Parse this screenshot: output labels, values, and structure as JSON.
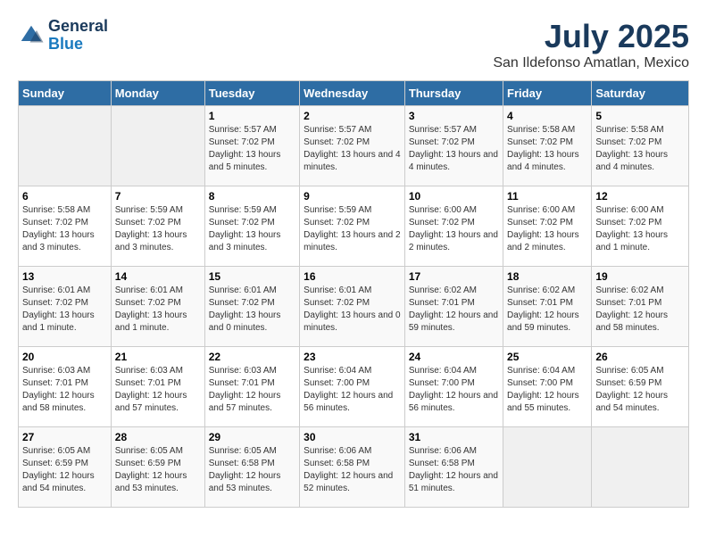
{
  "logo": {
    "line1": "General",
    "line2": "Blue"
  },
  "title": "July 2025",
  "subtitle": "San Ildefonso Amatlan, Mexico",
  "weekdays": [
    "Sunday",
    "Monday",
    "Tuesday",
    "Wednesday",
    "Thursday",
    "Friday",
    "Saturday"
  ],
  "weeks": [
    [
      {
        "day": "",
        "info": ""
      },
      {
        "day": "",
        "info": ""
      },
      {
        "day": "1",
        "info": "Sunrise: 5:57 AM\nSunset: 7:02 PM\nDaylight: 13 hours and 5 minutes."
      },
      {
        "day": "2",
        "info": "Sunrise: 5:57 AM\nSunset: 7:02 PM\nDaylight: 13 hours and 4 minutes."
      },
      {
        "day": "3",
        "info": "Sunrise: 5:57 AM\nSunset: 7:02 PM\nDaylight: 13 hours and 4 minutes."
      },
      {
        "day": "4",
        "info": "Sunrise: 5:58 AM\nSunset: 7:02 PM\nDaylight: 13 hours and 4 minutes."
      },
      {
        "day": "5",
        "info": "Sunrise: 5:58 AM\nSunset: 7:02 PM\nDaylight: 13 hours and 4 minutes."
      }
    ],
    [
      {
        "day": "6",
        "info": "Sunrise: 5:58 AM\nSunset: 7:02 PM\nDaylight: 13 hours and 3 minutes."
      },
      {
        "day": "7",
        "info": "Sunrise: 5:59 AM\nSunset: 7:02 PM\nDaylight: 13 hours and 3 minutes."
      },
      {
        "day": "8",
        "info": "Sunrise: 5:59 AM\nSunset: 7:02 PM\nDaylight: 13 hours and 3 minutes."
      },
      {
        "day": "9",
        "info": "Sunrise: 5:59 AM\nSunset: 7:02 PM\nDaylight: 13 hours and 2 minutes."
      },
      {
        "day": "10",
        "info": "Sunrise: 6:00 AM\nSunset: 7:02 PM\nDaylight: 13 hours and 2 minutes."
      },
      {
        "day": "11",
        "info": "Sunrise: 6:00 AM\nSunset: 7:02 PM\nDaylight: 13 hours and 2 minutes."
      },
      {
        "day": "12",
        "info": "Sunrise: 6:00 AM\nSunset: 7:02 PM\nDaylight: 13 hours and 1 minute."
      }
    ],
    [
      {
        "day": "13",
        "info": "Sunrise: 6:01 AM\nSunset: 7:02 PM\nDaylight: 13 hours and 1 minute."
      },
      {
        "day": "14",
        "info": "Sunrise: 6:01 AM\nSunset: 7:02 PM\nDaylight: 13 hours and 1 minute."
      },
      {
        "day": "15",
        "info": "Sunrise: 6:01 AM\nSunset: 7:02 PM\nDaylight: 13 hours and 0 minutes."
      },
      {
        "day": "16",
        "info": "Sunrise: 6:01 AM\nSunset: 7:02 PM\nDaylight: 13 hours and 0 minutes."
      },
      {
        "day": "17",
        "info": "Sunrise: 6:02 AM\nSunset: 7:01 PM\nDaylight: 12 hours and 59 minutes."
      },
      {
        "day": "18",
        "info": "Sunrise: 6:02 AM\nSunset: 7:01 PM\nDaylight: 12 hours and 59 minutes."
      },
      {
        "day": "19",
        "info": "Sunrise: 6:02 AM\nSunset: 7:01 PM\nDaylight: 12 hours and 58 minutes."
      }
    ],
    [
      {
        "day": "20",
        "info": "Sunrise: 6:03 AM\nSunset: 7:01 PM\nDaylight: 12 hours and 58 minutes."
      },
      {
        "day": "21",
        "info": "Sunrise: 6:03 AM\nSunset: 7:01 PM\nDaylight: 12 hours and 57 minutes."
      },
      {
        "day": "22",
        "info": "Sunrise: 6:03 AM\nSunset: 7:01 PM\nDaylight: 12 hours and 57 minutes."
      },
      {
        "day": "23",
        "info": "Sunrise: 6:04 AM\nSunset: 7:00 PM\nDaylight: 12 hours and 56 minutes."
      },
      {
        "day": "24",
        "info": "Sunrise: 6:04 AM\nSunset: 7:00 PM\nDaylight: 12 hours and 56 minutes."
      },
      {
        "day": "25",
        "info": "Sunrise: 6:04 AM\nSunset: 7:00 PM\nDaylight: 12 hours and 55 minutes."
      },
      {
        "day": "26",
        "info": "Sunrise: 6:05 AM\nSunset: 6:59 PM\nDaylight: 12 hours and 54 minutes."
      }
    ],
    [
      {
        "day": "27",
        "info": "Sunrise: 6:05 AM\nSunset: 6:59 PM\nDaylight: 12 hours and 54 minutes."
      },
      {
        "day": "28",
        "info": "Sunrise: 6:05 AM\nSunset: 6:59 PM\nDaylight: 12 hours and 53 minutes."
      },
      {
        "day": "29",
        "info": "Sunrise: 6:05 AM\nSunset: 6:58 PM\nDaylight: 12 hours and 53 minutes."
      },
      {
        "day": "30",
        "info": "Sunrise: 6:06 AM\nSunset: 6:58 PM\nDaylight: 12 hours and 52 minutes."
      },
      {
        "day": "31",
        "info": "Sunrise: 6:06 AM\nSunset: 6:58 PM\nDaylight: 12 hours and 51 minutes."
      },
      {
        "day": "",
        "info": ""
      },
      {
        "day": "",
        "info": ""
      }
    ]
  ]
}
